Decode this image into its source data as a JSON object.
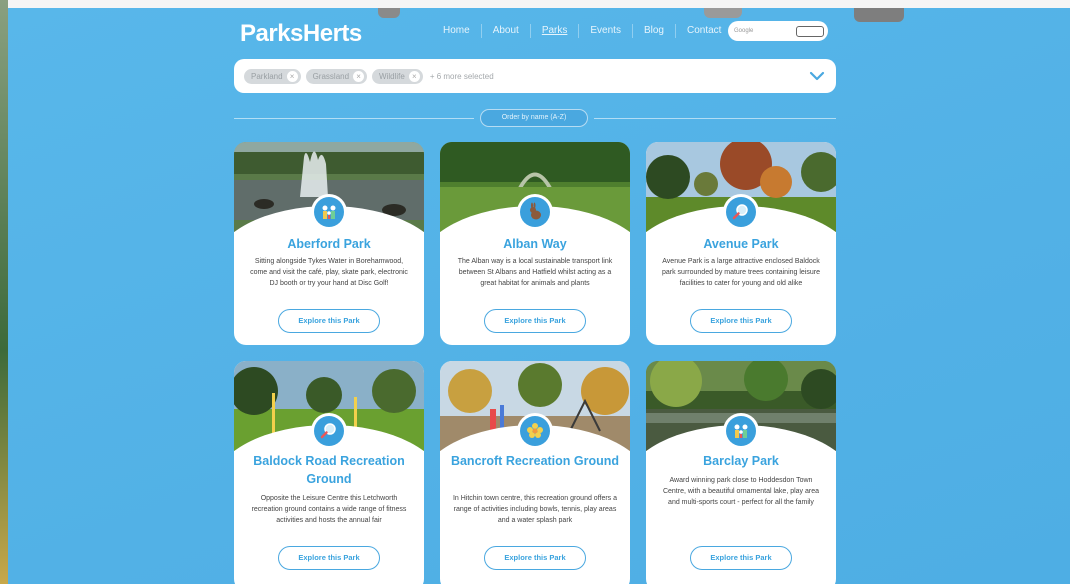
{
  "header": {
    "logo": "ParksHerts",
    "nav": [
      {
        "label": "Home",
        "active": false
      },
      {
        "label": "About",
        "active": false
      },
      {
        "label": "Parks",
        "active": true
      },
      {
        "label": "Events",
        "active": false
      },
      {
        "label": "Blog",
        "active": false
      },
      {
        "label": "Contact",
        "active": false
      }
    ],
    "search_placeholder": "Google"
  },
  "filter": {
    "chips": [
      "Parkland",
      "Grassland",
      "Wildlife"
    ],
    "more_text": "+ 6 more selected"
  },
  "order": {
    "label": "Order by name (A-Z)"
  },
  "parks": [
    {
      "name": "Aberford Park",
      "icon": "family-icon",
      "description": "Sitting alongside Tykes Water in Borehamwood, come and visit the café, play, skate park, electronic DJ booth or try your hand at Disc Golf!",
      "button": "Explore this Park",
      "photo": "fountain-lake"
    },
    {
      "name": "Alban Way",
      "icon": "rabbit-icon",
      "description": "The Alban way is a local sustainable transport link between St Albans and Hatfield whilst acting as a great habitat for animals and plants",
      "button": "Explore this Park",
      "photo": "green-path"
    },
    {
      "name": "Avenue Park",
      "icon": "magnifier-icon",
      "description": "Avenue Park is a large attractive enclosed Baldock park surrounded by mature trees containing leisure facilities to cater for young and old alike",
      "button": "Explore this Park",
      "photo": "autumn-trees"
    },
    {
      "name": "Baldock Road Recreation Ground",
      "icon": "magnifier-icon",
      "description": "Opposite the Leisure Centre this Letchworth recreation ground contains a wide range of fitness activities and hosts the annual fair",
      "button": "Explore this Park",
      "photo": "fitness-field"
    },
    {
      "name": "Bancroft Recreation Ground",
      "icon": "flower-icon",
      "description": "In Hitchin town centre, this recreation ground offers a range of activities including bowls, tennis, play areas and a water splash park",
      "button": "Explore this Park",
      "photo": "playground"
    },
    {
      "name": "Barclay Park",
      "icon": "family-icon",
      "description": "Award winning park close to Hoddesdon Town Centre, with a beautiful ornamental lake, play area and multi-sports court - perfect for all the family",
      "button": "Explore this Park",
      "photo": "river-trees"
    }
  ],
  "colors": {
    "background": "#58b7ea",
    "accent": "#3aa3de",
    "card": "#ffffff"
  }
}
